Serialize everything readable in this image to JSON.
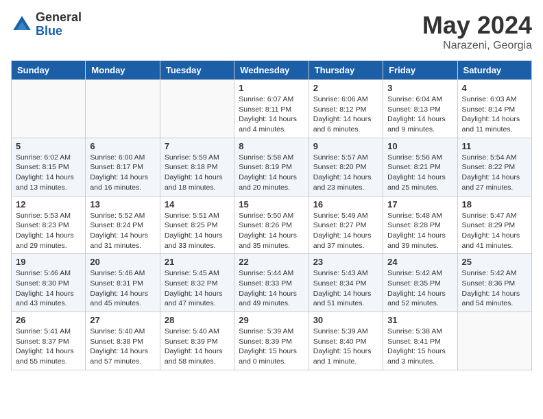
{
  "header": {
    "logo_general": "General",
    "logo_blue": "Blue",
    "month": "May 2024",
    "location": "Narazeni, Georgia"
  },
  "days_of_week": [
    "Sunday",
    "Monday",
    "Tuesday",
    "Wednesday",
    "Thursday",
    "Friday",
    "Saturday"
  ],
  "weeks": [
    [
      {
        "day": "",
        "sunrise": "",
        "sunset": "",
        "daylight": ""
      },
      {
        "day": "",
        "sunrise": "",
        "sunset": "",
        "daylight": ""
      },
      {
        "day": "",
        "sunrise": "",
        "sunset": "",
        "daylight": ""
      },
      {
        "day": "1",
        "sunrise": "Sunrise: 6:07 AM",
        "sunset": "Sunset: 8:11 PM",
        "daylight": "Daylight: 14 hours and 4 minutes."
      },
      {
        "day": "2",
        "sunrise": "Sunrise: 6:06 AM",
        "sunset": "Sunset: 8:12 PM",
        "daylight": "Daylight: 14 hours and 6 minutes."
      },
      {
        "day": "3",
        "sunrise": "Sunrise: 6:04 AM",
        "sunset": "Sunset: 8:13 PM",
        "daylight": "Daylight: 14 hours and 9 minutes."
      },
      {
        "day": "4",
        "sunrise": "Sunrise: 6:03 AM",
        "sunset": "Sunset: 8:14 PM",
        "daylight": "Daylight: 14 hours and 11 minutes."
      }
    ],
    [
      {
        "day": "5",
        "sunrise": "Sunrise: 6:02 AM",
        "sunset": "Sunset: 8:15 PM",
        "daylight": "Daylight: 14 hours and 13 minutes."
      },
      {
        "day": "6",
        "sunrise": "Sunrise: 6:00 AM",
        "sunset": "Sunset: 8:17 PM",
        "daylight": "Daylight: 14 hours and 16 minutes."
      },
      {
        "day": "7",
        "sunrise": "Sunrise: 5:59 AM",
        "sunset": "Sunset: 8:18 PM",
        "daylight": "Daylight: 14 hours and 18 minutes."
      },
      {
        "day": "8",
        "sunrise": "Sunrise: 5:58 AM",
        "sunset": "Sunset: 8:19 PM",
        "daylight": "Daylight: 14 hours and 20 minutes."
      },
      {
        "day": "9",
        "sunrise": "Sunrise: 5:57 AM",
        "sunset": "Sunset: 8:20 PM",
        "daylight": "Daylight: 14 hours and 23 minutes."
      },
      {
        "day": "10",
        "sunrise": "Sunrise: 5:56 AM",
        "sunset": "Sunset: 8:21 PM",
        "daylight": "Daylight: 14 hours and 25 minutes."
      },
      {
        "day": "11",
        "sunrise": "Sunrise: 5:54 AM",
        "sunset": "Sunset: 8:22 PM",
        "daylight": "Daylight: 14 hours and 27 minutes."
      }
    ],
    [
      {
        "day": "12",
        "sunrise": "Sunrise: 5:53 AM",
        "sunset": "Sunset: 8:23 PM",
        "daylight": "Daylight: 14 hours and 29 minutes."
      },
      {
        "day": "13",
        "sunrise": "Sunrise: 5:52 AM",
        "sunset": "Sunset: 8:24 PM",
        "daylight": "Daylight: 14 hours and 31 minutes."
      },
      {
        "day": "14",
        "sunrise": "Sunrise: 5:51 AM",
        "sunset": "Sunset: 8:25 PM",
        "daylight": "Daylight: 14 hours and 33 minutes."
      },
      {
        "day": "15",
        "sunrise": "Sunrise: 5:50 AM",
        "sunset": "Sunset: 8:26 PM",
        "daylight": "Daylight: 14 hours and 35 minutes."
      },
      {
        "day": "16",
        "sunrise": "Sunrise: 5:49 AM",
        "sunset": "Sunset: 8:27 PM",
        "daylight": "Daylight: 14 hours and 37 minutes."
      },
      {
        "day": "17",
        "sunrise": "Sunrise: 5:48 AM",
        "sunset": "Sunset: 8:28 PM",
        "daylight": "Daylight: 14 hours and 39 minutes."
      },
      {
        "day": "18",
        "sunrise": "Sunrise: 5:47 AM",
        "sunset": "Sunset: 8:29 PM",
        "daylight": "Daylight: 14 hours and 41 minutes."
      }
    ],
    [
      {
        "day": "19",
        "sunrise": "Sunrise: 5:46 AM",
        "sunset": "Sunset: 8:30 PM",
        "daylight": "Daylight: 14 hours and 43 minutes."
      },
      {
        "day": "20",
        "sunrise": "Sunrise: 5:46 AM",
        "sunset": "Sunset: 8:31 PM",
        "daylight": "Daylight: 14 hours and 45 minutes."
      },
      {
        "day": "21",
        "sunrise": "Sunrise: 5:45 AM",
        "sunset": "Sunset: 8:32 PM",
        "daylight": "Daylight: 14 hours and 47 minutes."
      },
      {
        "day": "22",
        "sunrise": "Sunrise: 5:44 AM",
        "sunset": "Sunset: 8:33 PM",
        "daylight": "Daylight: 14 hours and 49 minutes."
      },
      {
        "day": "23",
        "sunrise": "Sunrise: 5:43 AM",
        "sunset": "Sunset: 8:34 PM",
        "daylight": "Daylight: 14 hours and 51 minutes."
      },
      {
        "day": "24",
        "sunrise": "Sunrise: 5:42 AM",
        "sunset": "Sunset: 8:35 PM",
        "daylight": "Daylight: 14 hours and 52 minutes."
      },
      {
        "day": "25",
        "sunrise": "Sunrise: 5:42 AM",
        "sunset": "Sunset: 8:36 PM",
        "daylight": "Daylight: 14 hours and 54 minutes."
      }
    ],
    [
      {
        "day": "26",
        "sunrise": "Sunrise: 5:41 AM",
        "sunset": "Sunset: 8:37 PM",
        "daylight": "Daylight: 14 hours and 55 minutes."
      },
      {
        "day": "27",
        "sunrise": "Sunrise: 5:40 AM",
        "sunset": "Sunset: 8:38 PM",
        "daylight": "Daylight: 14 hours and 57 minutes."
      },
      {
        "day": "28",
        "sunrise": "Sunrise: 5:40 AM",
        "sunset": "Sunset: 8:39 PM",
        "daylight": "Daylight: 14 hours and 58 minutes."
      },
      {
        "day": "29",
        "sunrise": "Sunrise: 5:39 AM",
        "sunset": "Sunset: 8:39 PM",
        "daylight": "Daylight: 15 hours and 0 minutes."
      },
      {
        "day": "30",
        "sunrise": "Sunrise: 5:39 AM",
        "sunset": "Sunset: 8:40 PM",
        "daylight": "Daylight: 15 hours and 1 minute."
      },
      {
        "day": "31",
        "sunrise": "Sunrise: 5:38 AM",
        "sunset": "Sunset: 8:41 PM",
        "daylight": "Daylight: 15 hours and 3 minutes."
      },
      {
        "day": "",
        "sunrise": "",
        "sunset": "",
        "daylight": ""
      }
    ]
  ]
}
